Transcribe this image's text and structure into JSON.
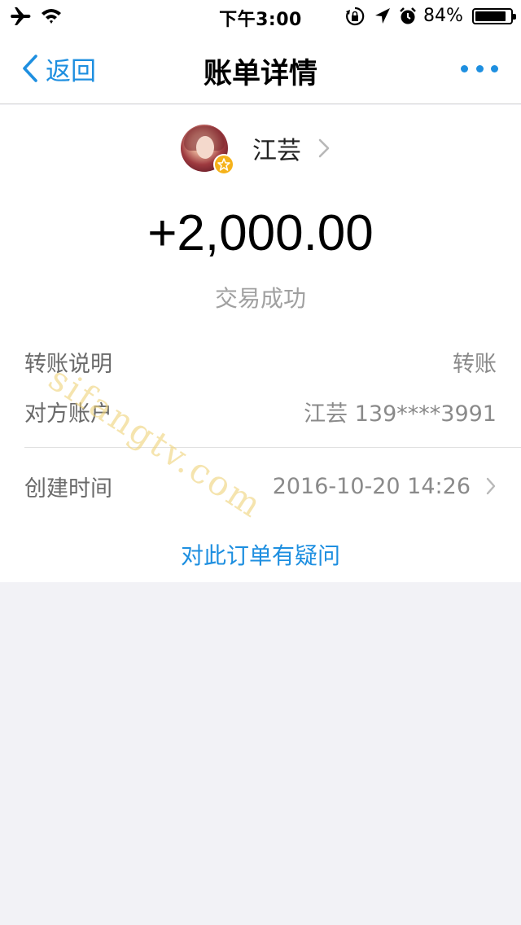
{
  "status_bar": {
    "time": "下午3:00",
    "battery_percent": "84%",
    "battery_level": 0.84,
    "icons": [
      "airplane-icon",
      "wifi-icon",
      "orientation-lock-icon",
      "location-icon",
      "alarm-icon",
      "battery-icon"
    ]
  },
  "nav": {
    "back_label": "返回",
    "title": "账单详情",
    "more_icon": "more-dots-icon",
    "accent_color": "#1e8fe0"
  },
  "payee": {
    "name": "江芸",
    "badge_icon": "star-icon"
  },
  "transaction": {
    "amount": "+2,000.00",
    "status": "交易成功"
  },
  "details": {
    "note_label": "转账说明",
    "note_value": "转账",
    "account_label": "对方账户",
    "account_value": "江芸 139****3991",
    "time_label": "创建时间",
    "time_value": "2016-10-20 14:26"
  },
  "question_link": "对此订单有疑问",
  "watermark": "sifangtv.com"
}
